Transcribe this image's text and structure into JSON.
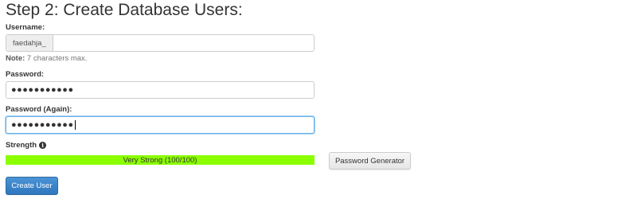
{
  "page_title": "Step 2: Create Database Users:",
  "username": {
    "label": "Username:",
    "prefix": "faedahja_",
    "value": "",
    "note_label": "Note:",
    "note_text": " 7 characters max."
  },
  "password": {
    "label": "Password:",
    "value_masked": "●●●●●●●●●●●"
  },
  "password_again": {
    "label": "Password (Again):",
    "value_masked": "●●●●●●●●●●●"
  },
  "strength": {
    "label": "Strength",
    "icon": "info-circle-icon",
    "text": "Very Strong (100/100)",
    "score_fraction": 1.0,
    "bar_color": "#8bff00"
  },
  "buttons": {
    "password_generator": "Password Generator",
    "create_user": "Create User"
  },
  "colors": {
    "primary": "#3a85c8",
    "focus": "#66afe9"
  }
}
